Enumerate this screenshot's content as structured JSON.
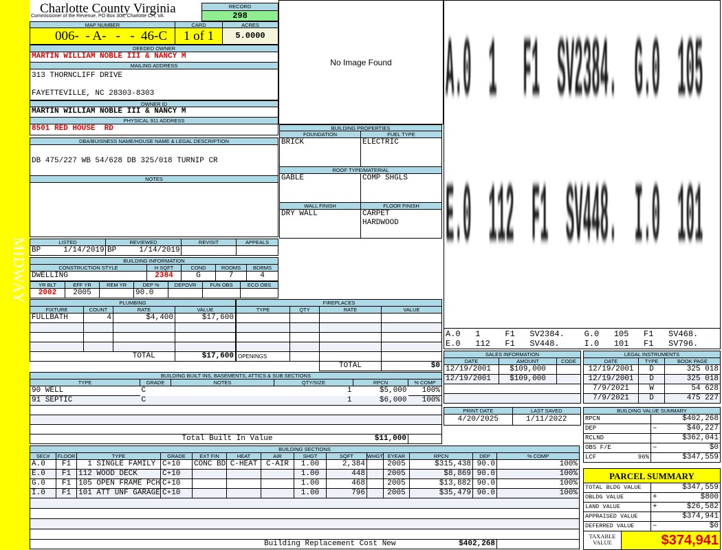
{
  "side_label": "MIDWAY",
  "header": {
    "title": "Charlotte County Virginia",
    "subtitle": "Commissioner of the Revenue, PO Box 308, Charlotte CH, VA",
    "record_label": "RECORD",
    "record": "298"
  },
  "parcel": {
    "map_label": "MAP NUMBER",
    "map_number": "006-  - A-   -   -  46-C",
    "card_label": "CARD",
    "card": "1 of 1",
    "acres_label": "ACRES",
    "acres": "5.0000"
  },
  "owner": {
    "deeded_label": "DEEDED OWNER",
    "deeded": "MARTIN WILLIAM NOBLE III & NANCY M",
    "mailing_label": "MAILING ADDRESS",
    "mailing_line1": "313 THORNCLIFF DRIVE",
    "mailing_line2": "FAYETTEVILLE, NC 28303-8303",
    "owner_id_label": "OWNER ID",
    "owner_id": "MARTIN WILLIAM NOBLE III & NANCY M",
    "physical_label": "PHYSICAL 911 ADDRESS",
    "physical": "8501 RED HOUSE  RD"
  },
  "dba": {
    "label": "DBA/BUISNESS NAME/HOUSE NAME & LEGAL DESCRIPTION",
    "text": "DB 475/227 WB 54/628 DB 325/018 TURNIP CR"
  },
  "notes": {
    "label": "NOTES",
    "text": ""
  },
  "image": {
    "text": "No Image Found"
  },
  "building_properties": {
    "title": "BUILDING PROPERTIES",
    "foundation_label": "FOUNDATION",
    "foundation": "BRICK",
    "fuel_label": "FUEL TYPE",
    "fuel": "ELECTRIC",
    "roof_label": "ROOF TYPE/MATERIAL",
    "roof_type": "GABLE",
    "roof_material": "COMP SHGLS",
    "wall_label": "WALL FINISH",
    "wall": "DRY WALL",
    "floor_label": "FLOOR FINISH",
    "floor1": "CARPET",
    "floor2": "HARDWOOD"
  },
  "review": {
    "listed_label": "LISTED",
    "listed": "BP     1/14/2019",
    "reviewed_label": "REVIEWED",
    "reviewed": "BP     1/14/2019",
    "revisit_label": "REVISIT",
    "appeals_label": "APPEALS"
  },
  "building_info": {
    "title": "BUILDING INFORMATION",
    "style_label": "CONSTRUCTION STYLE",
    "style": "DWELLING",
    "hsqft_label": "H SQFT",
    "hsqft": "2384",
    "cond_label": "COND",
    "cond": "G",
    "rooms_label": "ROOMS",
    "rooms": "7",
    "bdrms_label": "BDRMS",
    "bdrms": "4",
    "yrblt_label": "YR BLT",
    "yrblt": "2002",
    "effyr_label": "EFF YR",
    "effyr": "2005",
    "remyr_label": "REM YR",
    "dep_label": "DEP %",
    "dep": "90.0",
    "depovr_label": "DEPOVR",
    "funobs_label": "FUN OBS",
    "ecoobs_label": "ECO OBS"
  },
  "plumbing": {
    "title": "PLUMBING",
    "headers": [
      "FIXTURE",
      "COUNT",
      "RATE",
      "VALUE"
    ],
    "rows": [
      [
        "FULLBATH",
        "4",
        "$4,400",
        "$17,600"
      ]
    ],
    "total_label": "TOTAL",
    "total": "$17,600"
  },
  "fireplaces": {
    "title": "FIREPLACES",
    "headers": [
      "TYPE",
      "QTY",
      "RATE",
      "VALUE"
    ],
    "openings_label": "OPENINGS",
    "total_label": "TOTAL",
    "total": "$0"
  },
  "built_ins": {
    "title": "BUILDING BUILT INS, BASEMENTS, ATTICS & SUB SECTIONS",
    "headers": [
      "TYPE",
      "GRADE",
      "NOTES",
      "QTY/SIZE",
      "RPCN",
      "% COMP"
    ],
    "rows": [
      [
        "90 WELL",
        "C",
        "",
        "1",
        "$5,000",
        "100%"
      ],
      [
        "91 SEPTIC",
        "C",
        "",
        "1",
        "$6,000",
        "100%"
      ]
    ],
    "total_label": "Total Built In Value",
    "total": "$11,000"
  },
  "sections": {
    "title": "BUILDING SECTIONS",
    "headers": [
      "SEC#",
      "FLOOR",
      "TYPE",
      "GRADE",
      "EXT FIN",
      "HEAT",
      "AIR",
      "SHGT",
      "SQFT",
      "WHGT",
      "EYEAR",
      "RPCN",
      "DEP",
      "% COMP"
    ],
    "rows": [
      [
        "A.0",
        "F1",
        "  1 SINGLE FAMILY",
        "C+10",
        "CONC BD",
        "C-HEAT",
        "C-AIR",
        "1.00",
        "2,384",
        "",
        "2005",
        "$315,438",
        "90.0",
        "100%"
      ],
      [
        "E.0",
        "F1",
        "112 WOOD DECK",
        "C+10",
        "",
        "",
        "",
        "1.00",
        "448",
        "",
        "2005",
        "$8,869",
        "90.0",
        "100%"
      ],
      [
        "G.0",
        "F1",
        "105 OPEN FRAME PCH",
        "C+10",
        "",
        "",
        "",
        "1.00",
        "468",
        "",
        "2005",
        "$13,882",
        "90.0",
        "100%"
      ],
      [
        "I.0",
        "F1",
        "101 ATT UNF GARAGE",
        "C+10",
        "",
        "",
        "",
        "1.00",
        "796",
        "",
        "2005",
        "$35,479",
        "90.0",
        "100%"
      ]
    ],
    "total_label": "Building Replacement Cost New",
    "total": "$402,268"
  },
  "sketch": {
    "line1": "A.0  1   F1  SV2384.  G.0  105  F1  SV468.",
    "line2": "E.0  112  F1  SV448.  I.0  101  F1  SV796.",
    "legend1": "A.0   1     F1   SV2384.    G.0   105   F1   SV468.",
    "legend2": "E.0   112   F1   SV448.     I.0   101   F1   SV796."
  },
  "sales": {
    "title": "SALES INFORMATION",
    "headers": [
      "DATE",
      "AMOUNT",
      "CODE"
    ],
    "rows": [
      [
        "12/19/2001",
        "$109,000",
        ""
      ],
      [
        "12/19/2001",
        "$109,000",
        ""
      ]
    ]
  },
  "legal": {
    "title": "LEGAL INSTRUMENTS",
    "headers": [
      "DATE",
      "TYPE",
      "BOOK PAGE"
    ],
    "rows": [
      [
        "12/19/2001",
        "D",
        "325 018"
      ],
      [
        "12/19/2001",
        "D",
        "325 018"
      ],
      [
        "7/9/2021",
        "W",
        "54 628"
      ],
      [
        "7/9/2021",
        "D",
        "475 227"
      ]
    ]
  },
  "dates": {
    "print_label": "PRINT DATE",
    "print": "4/20/2025",
    "saved_label": "LAST SAVED",
    "saved": "1/11/2022"
  },
  "value_summary": {
    "title": "BUILDING VALUE SUMMARY",
    "rows": [
      {
        "label": "RPCN",
        "sign": "",
        "value": "$402,268"
      },
      {
        "label": "DEP",
        "sign": "–",
        "value": "$40,227"
      },
      {
        "label": "RCLND",
        "sign": "",
        "value": "$362,041"
      },
      {
        "label": "OBS F/E",
        "sign": "–",
        "value": "$0"
      },
      {
        "label": "LCF",
        "pct": "96%",
        "sign": "",
        "value": "$347,559"
      }
    ]
  },
  "parcel_summary": {
    "title": "PARCEL SUMMARY",
    "rows": [
      {
        "label": "TOTAL BLDG VALUE",
        "sign": "",
        "value": "$347,559"
      },
      {
        "label": "OBLDG VALUE",
        "sign": "+",
        "value": "$800"
      },
      {
        "label": "LAND VALUE",
        "sign": "+",
        "value": "$26,582"
      },
      {
        "label": "APPRAISED VALUE",
        "sign": "",
        "value": "$374,941"
      },
      {
        "label": "DEFERRED VALUE",
        "sign": "–",
        "value": "$0"
      }
    ],
    "taxable_label": "TAXABLE VALUE",
    "taxable": "$374,941"
  },
  "colors": {
    "label_bg": "#add8e6",
    "highlight": "#ffff00",
    "record_bg": "#90ee90",
    "red_text": "#e00000"
  }
}
